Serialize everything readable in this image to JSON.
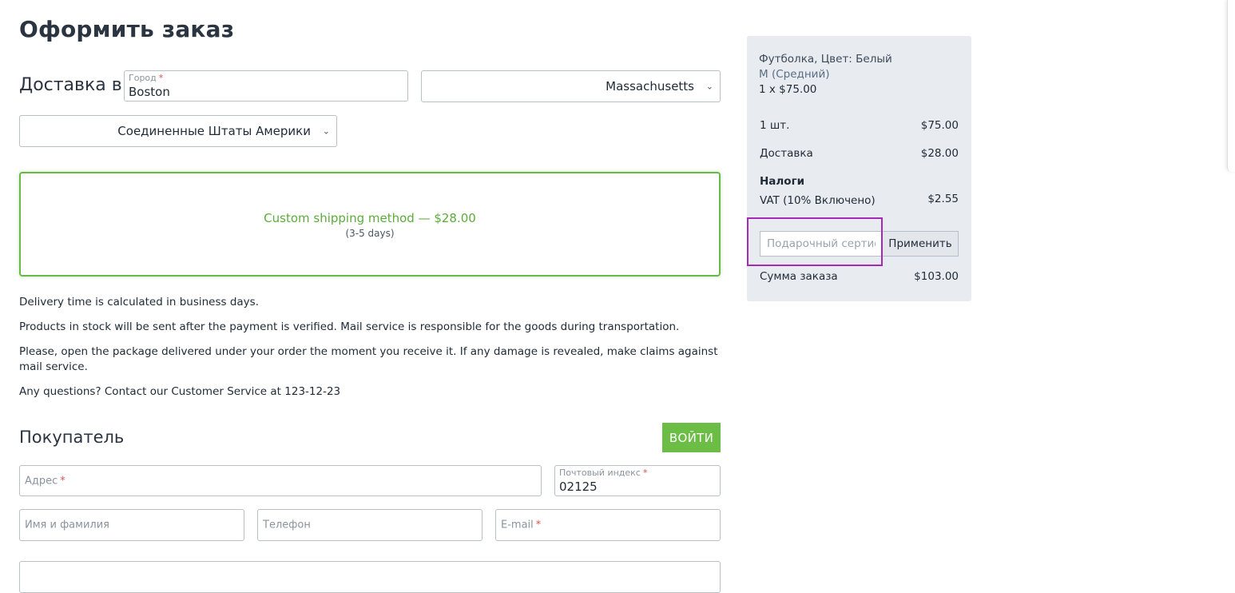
{
  "page": {
    "title": "Оформить заказ"
  },
  "shipping": {
    "label": "Доставка в",
    "city": {
      "label": "Город",
      "required": "*",
      "value": "Boston"
    },
    "state": {
      "value": "Massachusetts"
    },
    "country": {
      "value": "Соединенные Штаты Америки"
    },
    "method": {
      "name": "Custom shipping method — $28.00",
      "days": "(3-5 days)"
    }
  },
  "info": [
    "Delivery time is calculated in business days.",
    "Products in stock will be sent after the payment is verified. Mail service is responsible for the goods during transportation.",
    "Please, open the package delivered under your order the moment you receive it. If any damage is revealed, make claims against mail service.",
    "Any questions? Contact our Customer Service at 123-12-23"
  ],
  "buyer": {
    "title": "Покупатель",
    "login_label": "ВОЙТИ",
    "address": {
      "placeholder": "Адрес",
      "required": "*"
    },
    "zip": {
      "label": "Почтовый индекс",
      "required": "*",
      "value": "02125"
    },
    "name": {
      "placeholder": "Имя и фамилия"
    },
    "phone": {
      "placeholder": "Телефон"
    },
    "email": {
      "placeholder": "E-mail",
      "required": "*"
    }
  },
  "summary": {
    "product": {
      "name": "Футболка, Цвет: Белый",
      "variant": "M (Средний)",
      "qty_price": "1 x $75.00"
    },
    "items": {
      "label": "1 шт.",
      "value": "$75.00"
    },
    "delivery": {
      "label": "Доставка",
      "value": "$28.00"
    },
    "taxes": {
      "title": "Налоги",
      "label": "VAT (10% Включено)",
      "value": "$2.55"
    },
    "gift": {
      "placeholder": "Подарочный сертификат или промокод",
      "apply_label": "Применить"
    },
    "total": {
      "label": "Сумма заказа",
      "value": "$103.00"
    }
  },
  "colors": {
    "accent_green": "#6cbd45",
    "highlight_purple": "#a22ab7",
    "summary_bg": "#e8ebef"
  }
}
